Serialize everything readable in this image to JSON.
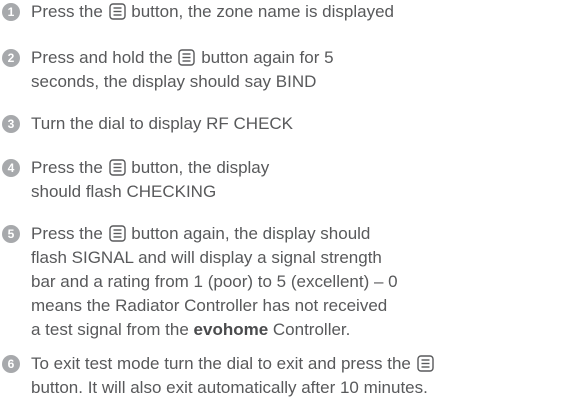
{
  "steps": [
    {
      "number": "1",
      "lines": [
        [
          "Press the ",
          {
            "icon": "menu-button-icon"
          },
          " button, the zone name is displayed"
        ]
      ]
    },
    {
      "number": "2",
      "lines": [
        [
          "Press and hold the ",
          {
            "icon": "menu-button-icon"
          },
          " button again for 5"
        ],
        [
          "seconds, the display should say BIND"
        ]
      ]
    },
    {
      "number": "3",
      "lines": [
        [
          "Turn the dial to display RF CHECK"
        ]
      ]
    },
    {
      "number": "4",
      "lines": [
        [
          "Press the ",
          {
            "icon": "menu-button-icon"
          },
          " button, the display"
        ],
        [
          "should flash CHECKING"
        ]
      ]
    },
    {
      "number": "5",
      "lines": [
        [
          "Press the ",
          {
            "icon": "menu-button-icon"
          },
          " button again, the display should"
        ],
        [
          "flash SIGNAL and will display a signal strength"
        ],
        [
          "bar and a rating from 1 (poor) to 5 (excellent) – 0"
        ],
        [
          "means the Radiator Controller has not received"
        ],
        [
          "a test signal from the ",
          {
            "bold": "evohome"
          },
          " Controller."
        ]
      ]
    },
    {
      "number": "6",
      "lines": [
        [
          "To exit test mode turn the dial to exit and press the ",
          {
            "icon": "menu-button-icon"
          }
        ],
        [
          "button. It will also exit automatically after 10 minutes."
        ]
      ]
    }
  ]
}
